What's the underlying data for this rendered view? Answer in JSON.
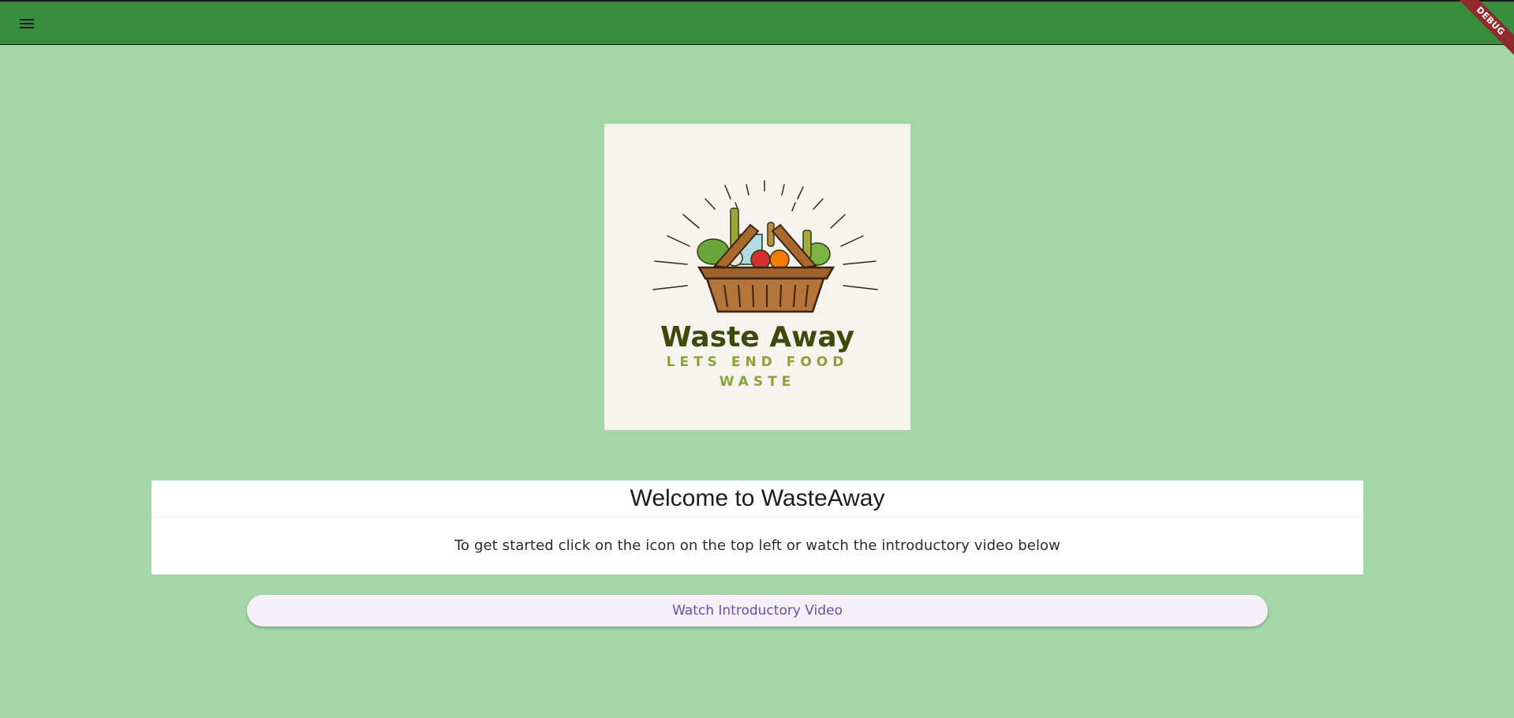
{
  "appbar": {
    "menu_icon": "menu-icon",
    "debug_label": "DEBUG",
    "color": "#388e3c"
  },
  "logo": {
    "title": "Waste Away",
    "tagline_line1": "LETS END FOOD",
    "tagline_line2": "WASTE",
    "title_color": "#3d4a0c",
    "tagline_color": "#8aa23a"
  },
  "welcome": {
    "title": "Welcome to WasteAway",
    "subtitle": "To get started click on the icon on the top left or watch the introductory video below"
  },
  "video_button": {
    "label": "Watch Introductory Video",
    "color": "#6750a4"
  },
  "colors": {
    "background": "#a5d6a7",
    "card": "#ffffff"
  }
}
